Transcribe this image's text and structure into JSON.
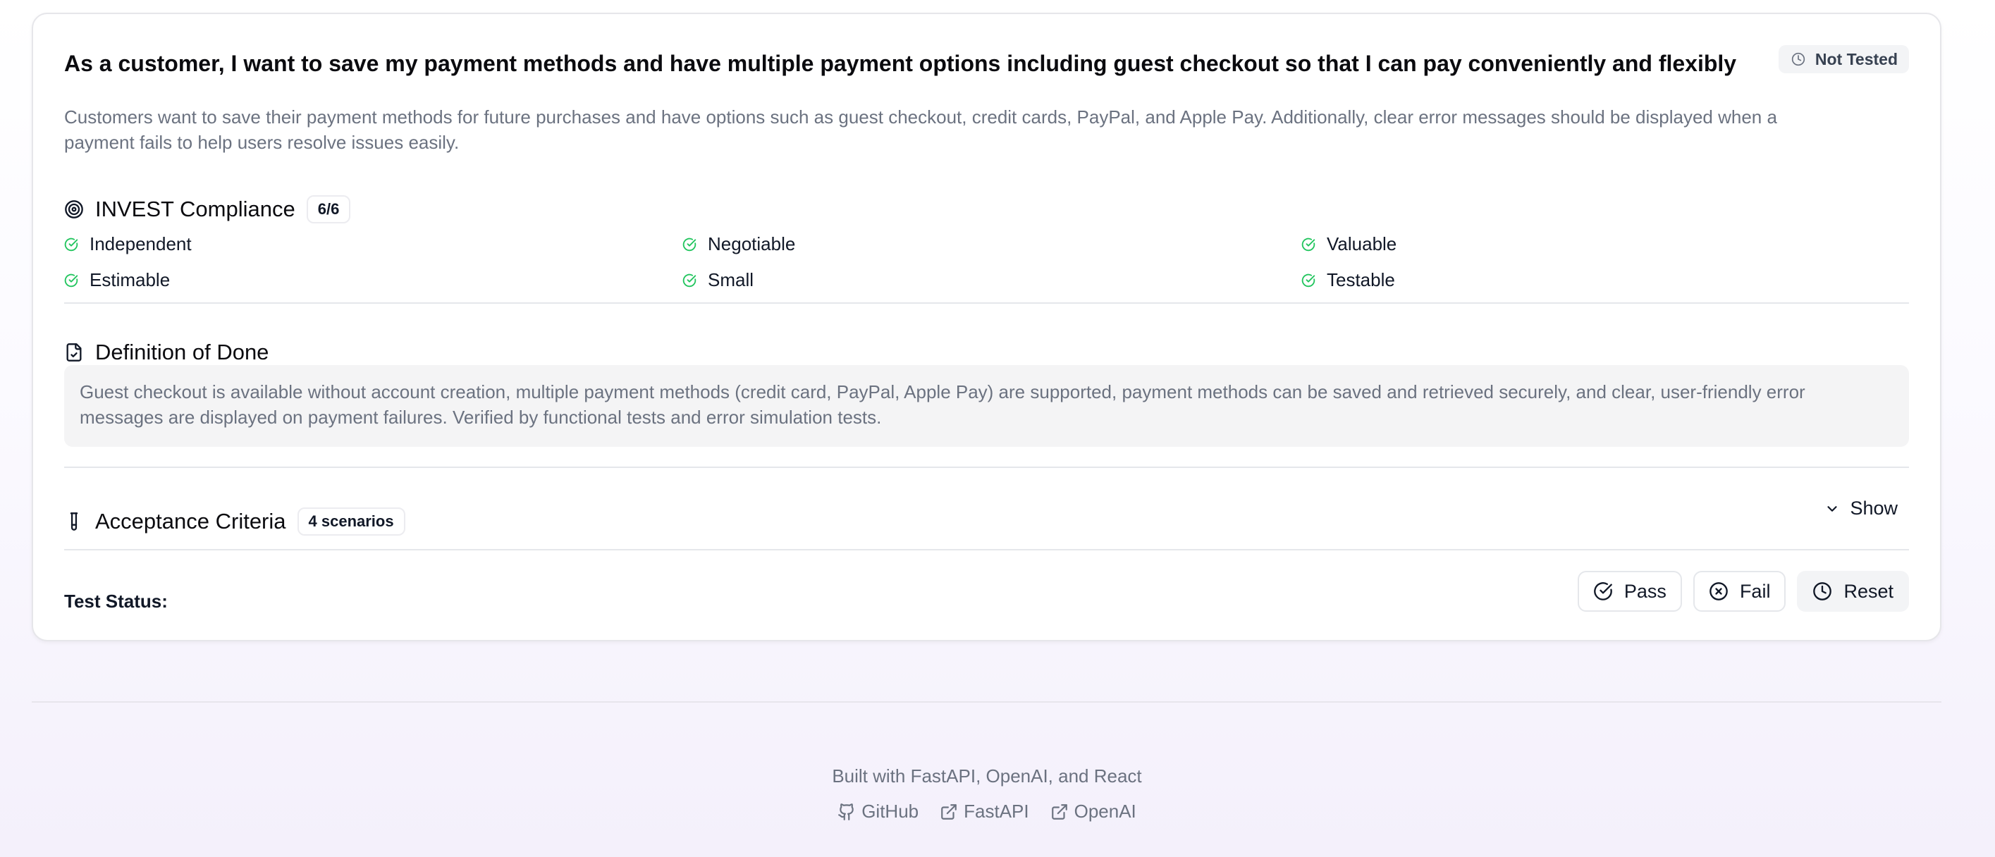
{
  "story": {
    "title": "As a customer, I want to save my payment methods and have multiple payment options including guest checkout so that I can pay conveniently and flexibly",
    "description": "Customers want to save their payment methods for future purchases and have options such as guest checkout, credit cards, PayPal, and Apple Pay. Additionally, clear error messages should be displayed when a payment fails to help users resolve issues easily.",
    "status": "Not Tested"
  },
  "invest": {
    "heading": "INVEST Compliance",
    "score": "6/6",
    "items": [
      "Independent",
      "Negotiable",
      "Valuable",
      "Estimable",
      "Small",
      "Testable"
    ]
  },
  "dod": {
    "heading": "Definition of Done",
    "text": "Guest checkout is available without account creation, multiple payment methods (credit card, PayPal, Apple Pay) are supported, payment methods can be saved and retrieved securely, and clear, user-friendly error messages are displayed on payment failures. Verified by functional tests and error simulation tests."
  },
  "acceptance": {
    "heading": "Acceptance Criteria",
    "count": "4 scenarios",
    "toggle_label": "Show"
  },
  "test_status": {
    "label": "Test Status:",
    "pass": "Pass",
    "fail": "Fail",
    "reset": "Reset"
  },
  "footer": {
    "built_with": "Built with FastAPI, OpenAI, and React",
    "links": [
      "GitHub",
      "FastAPI",
      "OpenAI"
    ]
  },
  "colors": {
    "check_green": "#22c55e",
    "muted_text": "#6b7280"
  },
  "icons": {
    "status": "clock-icon",
    "invest": "target-icon",
    "check": "check-circle-icon",
    "dod": "file-check-icon",
    "acceptance": "test-tube-icon",
    "toggle": "chevron-down-icon",
    "pass": "check-circle-icon",
    "fail": "x-circle-icon",
    "reset": "clock-icon",
    "github": "github-icon",
    "external": "external-link-icon"
  }
}
